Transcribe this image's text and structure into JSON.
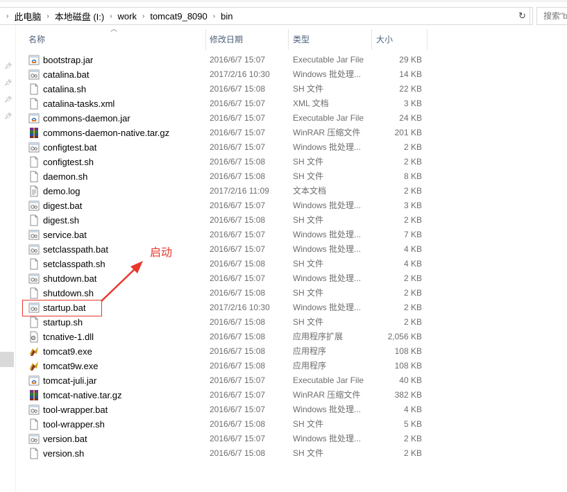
{
  "address": {
    "breadcrumbs": [
      "此电脑",
      "本地磁盘 (I:)",
      "work",
      "tomcat9_8090",
      "bin"
    ],
    "search_placeholder": "搜索\"bin\""
  },
  "columns": {
    "name": "名称",
    "date": "修改日期",
    "type": "类型",
    "size": "大小"
  },
  "files": [
    {
      "name": "bootstrap.jar",
      "date": "2016/6/7 15:07",
      "type": "Executable Jar File",
      "size": "29 KB",
      "icon": "jar-file-icon"
    },
    {
      "name": "catalina.bat",
      "date": "2017/2/16 10:30",
      "type": "Windows 批处理...",
      "size": "14 KB",
      "icon": "bat-file-icon"
    },
    {
      "name": "catalina.sh",
      "date": "2016/6/7 15:08",
      "type": "SH 文件",
      "size": "22 KB",
      "icon": "blank-file-icon"
    },
    {
      "name": "catalina-tasks.xml",
      "date": "2016/6/7 15:07",
      "type": "XML 文档",
      "size": "3 KB",
      "icon": "blank-file-icon"
    },
    {
      "name": "commons-daemon.jar",
      "date": "2016/6/7 15:07",
      "type": "Executable Jar File",
      "size": "24 KB",
      "icon": "jar-file-icon"
    },
    {
      "name": "commons-daemon-native.tar.gz",
      "date": "2016/6/7 15:07",
      "type": "WinRAR 压缩文件",
      "size": "201 KB",
      "icon": "winrar-archive-icon"
    },
    {
      "name": "configtest.bat",
      "date": "2016/6/7 15:07",
      "type": "Windows 批处理...",
      "size": "2 KB",
      "icon": "bat-file-icon"
    },
    {
      "name": "configtest.sh",
      "date": "2016/6/7 15:08",
      "type": "SH 文件",
      "size": "2 KB",
      "icon": "blank-file-icon"
    },
    {
      "name": "daemon.sh",
      "date": "2016/6/7 15:08",
      "type": "SH 文件",
      "size": "8 KB",
      "icon": "blank-file-icon"
    },
    {
      "name": "demo.log",
      "date": "2017/2/16 11:09",
      "type": "文本文档",
      "size": "2 KB",
      "icon": "text-file-icon"
    },
    {
      "name": "digest.bat",
      "date": "2016/6/7 15:07",
      "type": "Windows 批处理...",
      "size": "3 KB",
      "icon": "bat-file-icon"
    },
    {
      "name": "digest.sh",
      "date": "2016/6/7 15:08",
      "type": "SH 文件",
      "size": "2 KB",
      "icon": "blank-file-icon"
    },
    {
      "name": "service.bat",
      "date": "2016/6/7 15:07",
      "type": "Windows 批处理...",
      "size": "7 KB",
      "icon": "bat-file-icon"
    },
    {
      "name": "setclasspath.bat",
      "date": "2016/6/7 15:07",
      "type": "Windows 批处理...",
      "size": "4 KB",
      "icon": "bat-file-icon"
    },
    {
      "name": "setclasspath.sh",
      "date": "2016/6/7 15:08",
      "type": "SH 文件",
      "size": "4 KB",
      "icon": "blank-file-icon"
    },
    {
      "name": "shutdown.bat",
      "date": "2016/6/7 15:07",
      "type": "Windows 批处理...",
      "size": "2 KB",
      "icon": "bat-file-icon"
    },
    {
      "name": "shutdown.sh",
      "date": "2016/6/7 15:08",
      "type": "SH 文件",
      "size": "2 KB",
      "icon": "blank-file-icon"
    },
    {
      "name": "startup.bat",
      "date": "2017/2/16 10:30",
      "type": "Windows 批处理...",
      "size": "2 KB",
      "icon": "bat-file-icon"
    },
    {
      "name": "startup.sh",
      "date": "2016/6/7 15:08",
      "type": "SH 文件",
      "size": "2 KB",
      "icon": "blank-file-icon"
    },
    {
      "name": "tcnative-1.dll",
      "date": "2016/6/7 15:08",
      "type": "应用程序扩展",
      "size": "2,056 KB",
      "icon": "dll-file-icon"
    },
    {
      "name": "tomcat9.exe",
      "date": "2016/6/7 15:08",
      "type": "应用程序",
      "size": "108 KB",
      "icon": "tomcat-exe-icon"
    },
    {
      "name": "tomcat9w.exe",
      "date": "2016/6/7 15:08",
      "type": "应用程序",
      "size": "108 KB",
      "icon": "tomcat-exe-icon"
    },
    {
      "name": "tomcat-juli.jar",
      "date": "2016/6/7 15:07",
      "type": "Executable Jar File",
      "size": "40 KB",
      "icon": "jar-file-icon"
    },
    {
      "name": "tomcat-native.tar.gz",
      "date": "2016/6/7 15:07",
      "type": "WinRAR 压缩文件",
      "size": "382 KB",
      "icon": "winrar-archive-icon"
    },
    {
      "name": "tool-wrapper.bat",
      "date": "2016/6/7 15:07",
      "type": "Windows 批处理...",
      "size": "4 KB",
      "icon": "bat-file-icon"
    },
    {
      "name": "tool-wrapper.sh",
      "date": "2016/6/7 15:08",
      "type": "SH 文件",
      "size": "5 KB",
      "icon": "blank-file-icon"
    },
    {
      "name": "version.bat",
      "date": "2016/6/7 15:07",
      "type": "Windows 批处理...",
      "size": "2 KB",
      "icon": "bat-file-icon"
    },
    {
      "name": "version.sh",
      "date": "2016/6/7 15:08",
      "type": "SH 文件",
      "size": "2 KB",
      "icon": "blank-file-icon"
    }
  ],
  "annotation": {
    "label": "启动",
    "target": "startup.bat",
    "color": "#e8372b"
  },
  "colors": {
    "header_text": "#4c607a",
    "detail_text": "#6d6d6d",
    "annotation": "#e8372b"
  }
}
